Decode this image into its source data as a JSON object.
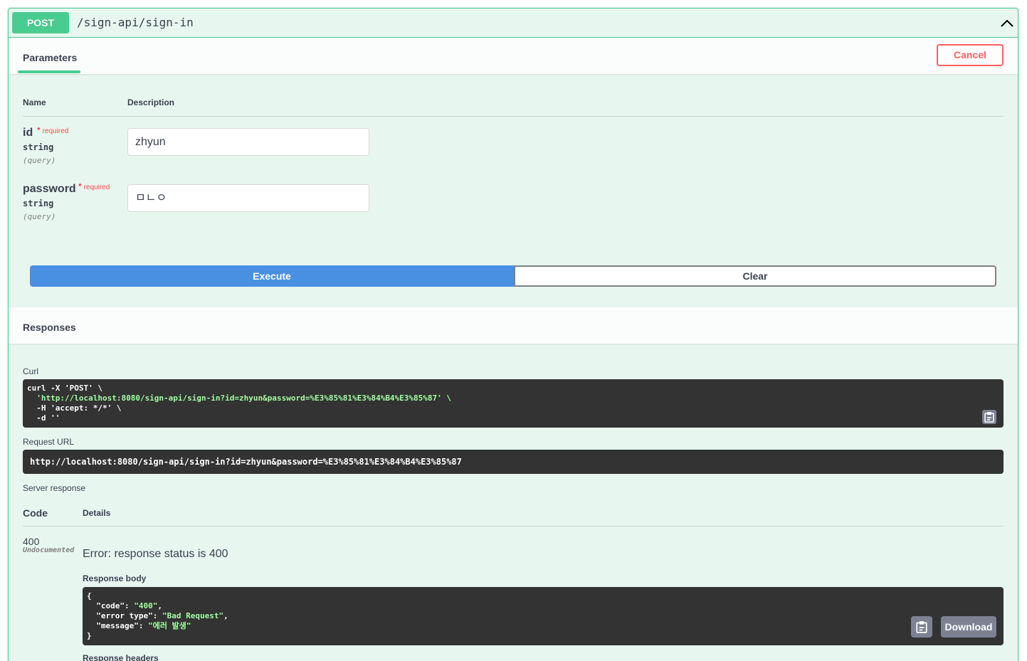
{
  "summary": {
    "method": "POST",
    "path": "/sign-api/sign-in"
  },
  "tabs": {
    "parameters_label": "Parameters",
    "cancel_label": "Cancel"
  },
  "params_table": {
    "name_header": "Name",
    "description_header": "Description",
    "params": [
      {
        "name": "id",
        "required_label": "required",
        "type": "string",
        "location": "(query)",
        "value": "zhyun"
      },
      {
        "name": "password",
        "required_label": "required",
        "type": "string",
        "location": "(query)",
        "value": "ㅁㄴㅇ"
      }
    ]
  },
  "actions": {
    "execute_label": "Execute",
    "clear_label": "Clear"
  },
  "responses": {
    "title": "Responses",
    "curl_label": "Curl",
    "curl_lines": [
      "curl -X 'POST' \\",
      "  'http://localhost:8080/sign-api/sign-in?id=zhyun&password=%E3%85%81%E3%84%B4%E3%85%87' \\",
      "  -H 'accept: */*' \\",
      "  -d ''"
    ],
    "request_url_label": "Request URL",
    "request_url": "http://localhost:8080/sign-api/sign-in?id=zhyun&password=%E3%85%81%E3%84%B4%E3%85%87",
    "server_response_label": "Server response",
    "code_header": "Code",
    "details_header": "Details",
    "status_code": "400",
    "undocumented_label": "Undocumented",
    "error_message": "Error: response status is 400",
    "response_body_label": "Response body",
    "body_lines": {
      "open": "{",
      "code_key": "\"code\"",
      "code_value": "\"400\"",
      "error_type_key": "\"error type\"",
      "error_type_value": "\"Bad Request\"",
      "message_key": "\"message\"",
      "message_value": "\"에러 발생\"",
      "close": "}"
    },
    "download_label": "Download",
    "response_headers_label": "Response headers"
  },
  "colors": {
    "post_accent": "#49cc90",
    "execute_blue": "#4990e2",
    "cancel_red": "#ff6060",
    "code_bg": "#333333"
  }
}
